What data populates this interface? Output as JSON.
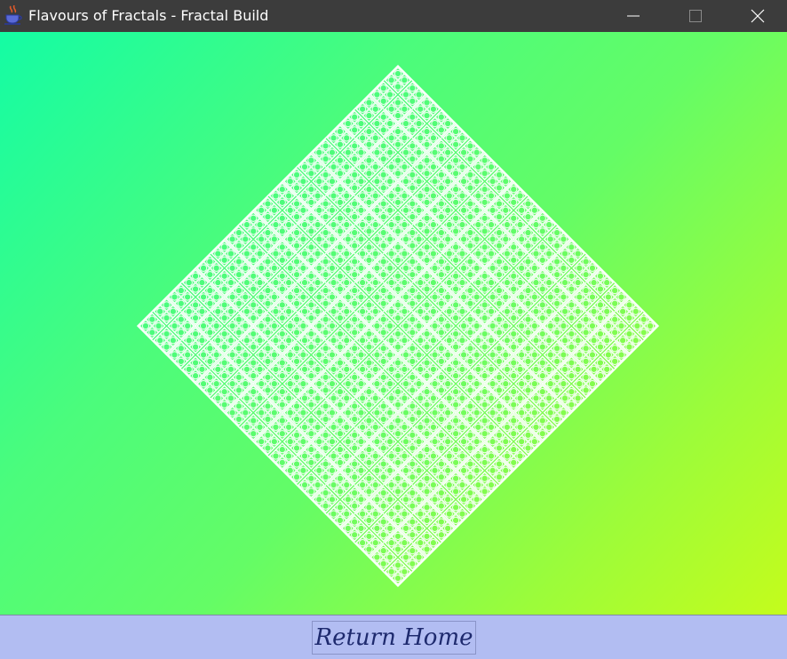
{
  "window": {
    "title": "Flavours of Fractals - Fractal Build",
    "icon": "java-coffee-cup-icon",
    "controls": [
      "minimize-icon",
      "maximize-icon",
      "close-icon"
    ]
  },
  "canvas": {
    "background_gradient": [
      "#14fca4",
      "#64fc66",
      "#c4fc1c"
    ],
    "fractal_color": "#ffffff",
    "fractal_shape": "diamond"
  },
  "footer": {
    "return_home_label": "Return Home",
    "panel_color": "#b2bdf2",
    "text_color": "#1e2a6e"
  }
}
